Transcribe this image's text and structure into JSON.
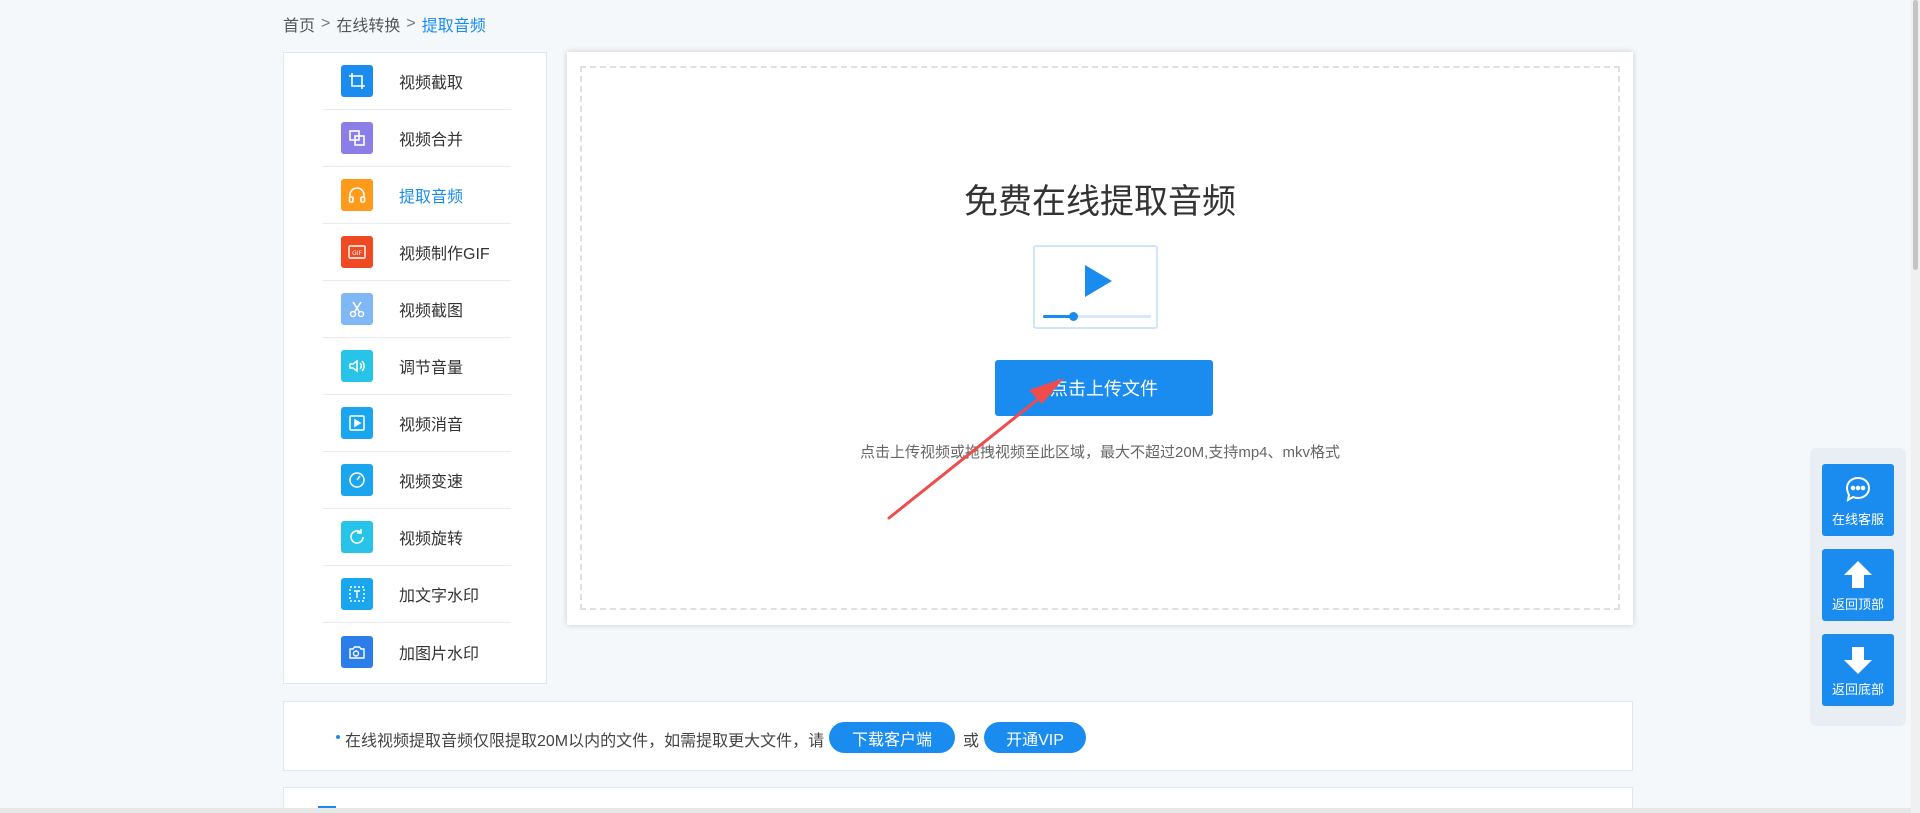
{
  "breadcrumb": {
    "home": "首页",
    "separator": ">",
    "category": "在线转换",
    "current": "提取音频"
  },
  "sidebar": {
    "items": [
      {
        "label": "视频截取",
        "icon": "crop-icon",
        "color": "#1a8cf0"
      },
      {
        "label": "视频合并",
        "icon": "merge-icon",
        "color": "#8b7ee8"
      },
      {
        "label": "提取音频",
        "icon": "headphones-icon",
        "color": "#ff9a1a",
        "active": true
      },
      {
        "label": "视频制作GIF",
        "icon": "gif-icon",
        "color": "#f04a22"
      },
      {
        "label": "视频截图",
        "icon": "scissors-icon",
        "color": "#7fb8f5"
      },
      {
        "label": "调节音量",
        "icon": "volume-icon",
        "color": "#27c3e8"
      },
      {
        "label": "视频消音",
        "icon": "play-box-icon",
        "color": "#1aa6ef"
      },
      {
        "label": "视频变速",
        "icon": "speedometer-icon",
        "color": "#1aa6ef"
      },
      {
        "label": "视频旋转",
        "icon": "rotate-icon",
        "color": "#27c3e8"
      },
      {
        "label": "加文字水印",
        "icon": "text-watermark-icon",
        "color": "#1aa6ef"
      },
      {
        "label": "加图片水印",
        "icon": "image-watermark-icon",
        "color": "#2b7de9"
      }
    ]
  },
  "upload": {
    "title": "免费在线提取音频",
    "button_label": "点击上传文件",
    "hint": "点击上传视频或拖拽视频至此区域，最大不超过20M,支持mp4、mkv格式"
  },
  "notice": {
    "text": "在线视频提取音频仅限提取20M以内的文件，如需提取更大文件，请",
    "download_label": "下载客户端",
    "or_text": "或",
    "vip_label": "开通VIP"
  },
  "float_bar": {
    "service_label": "在线客服",
    "top_label": "返回顶部",
    "bottom_label": "返回底部"
  },
  "colors": {
    "accent": "#1a8cf0",
    "annotation_arrow": "#ef4d4d"
  }
}
